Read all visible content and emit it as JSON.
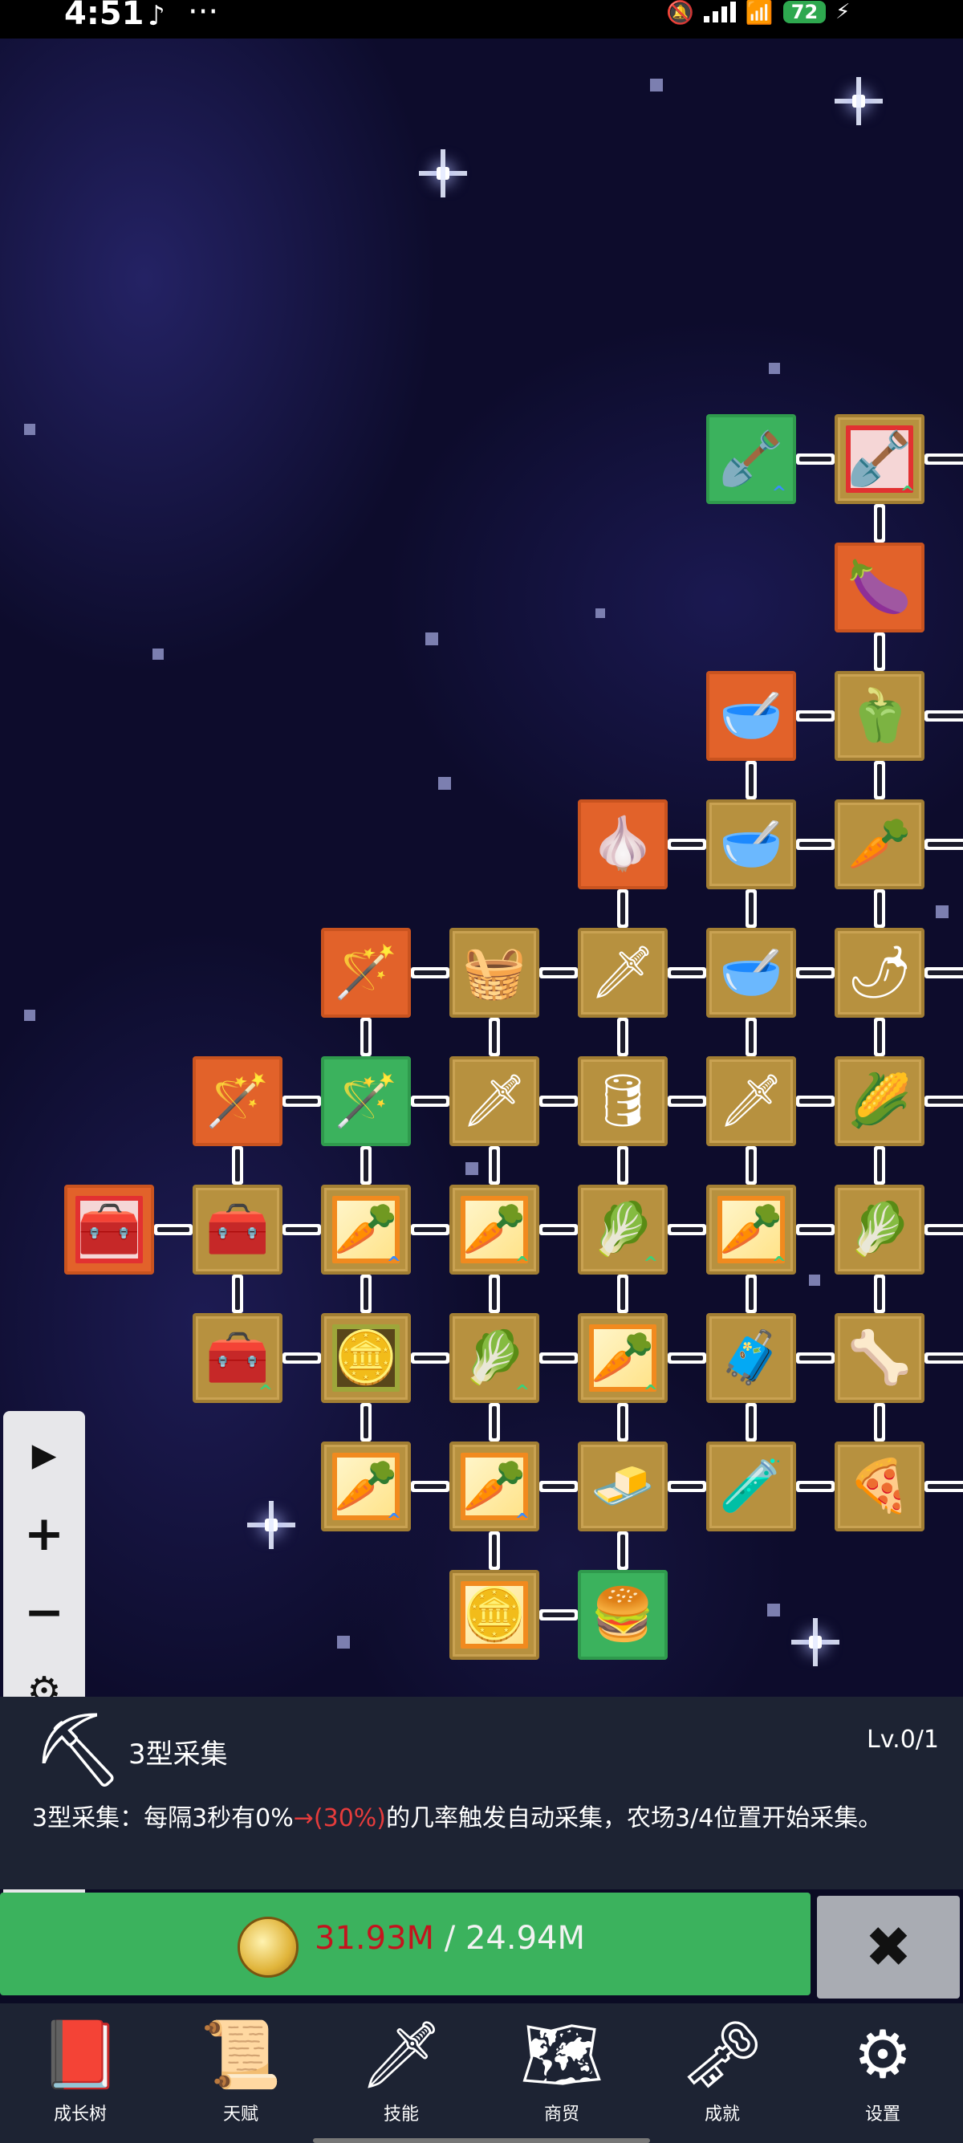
{
  "status_bar": {
    "time": "4:51",
    "more": "···",
    "app_icon": "tiktok-icon",
    "battery": "72"
  },
  "toolbar": {
    "buttons": [
      "play-icon",
      "zoom-in-icon",
      "zoom-out-icon",
      "settings-icon",
      "eye-icon",
      "move-icon",
      "close-icon"
    ]
  },
  "tree": {
    "nodes": [
      {
        "id": "n1",
        "icon": "shovel-icon",
        "style": "green",
        "upgrade": "blue"
      },
      {
        "id": "n2",
        "icon": "shovel-icon",
        "style": "gold",
        "frame": "red",
        "upgrade": "green"
      },
      {
        "id": "n3",
        "icon": "eggplant-icon",
        "style": "orange"
      },
      {
        "id": "n4",
        "icon": "bowl-icon",
        "style": "orange"
      },
      {
        "id": "n5",
        "icon": "pepper-icon",
        "style": "gold"
      },
      {
        "id": "n6",
        "icon": "garlic-icon",
        "style": "orange"
      },
      {
        "id": "n7",
        "icon": "bowl-icon",
        "style": "gold"
      },
      {
        "id": "n8",
        "icon": "radish-icon",
        "style": "gold"
      },
      {
        "id": "n9",
        "icon": "staff-icon",
        "style": "orange"
      },
      {
        "id": "n10",
        "icon": "crate-icon",
        "style": "gold"
      },
      {
        "id": "n11",
        "icon": "sword-icon",
        "style": "gold"
      },
      {
        "id": "n12",
        "icon": "bowl-icon",
        "style": "gold"
      },
      {
        "id": "n13",
        "icon": "chili-icon",
        "style": "gold"
      },
      {
        "id": "n14",
        "icon": "wand-icon",
        "style": "orange"
      },
      {
        "id": "n15",
        "icon": "staff-icon",
        "style": "green"
      },
      {
        "id": "n16",
        "icon": "sword-icon",
        "style": "gold"
      },
      {
        "id": "n17",
        "icon": "barrel-icon",
        "style": "gold"
      },
      {
        "id": "n18",
        "icon": "sword-icon",
        "style": "gold"
      },
      {
        "id": "n19",
        "icon": "corn-icon",
        "style": "gold"
      },
      {
        "id": "n20",
        "icon": "chest-icon",
        "style": "orange",
        "frame": "red"
      },
      {
        "id": "n21",
        "icon": "chest-icon",
        "style": "gold"
      },
      {
        "id": "n22",
        "icon": "carrot-icon",
        "style": "gold",
        "frame": "orange",
        "upgrade": "blue"
      },
      {
        "id": "n23",
        "icon": "carrot-icon",
        "style": "gold",
        "frame": "orange",
        "upgrade": "green"
      },
      {
        "id": "n24",
        "icon": "cabbage-icon",
        "style": "gold",
        "upgrade": "green"
      },
      {
        "id": "n25",
        "icon": "carrot-icon",
        "style": "gold",
        "frame": "orange",
        "upgrade": "green"
      },
      {
        "id": "n26",
        "icon": "cabbage-icon",
        "style": "gold"
      },
      {
        "id": "n27",
        "icon": "chest-icon",
        "style": "gold",
        "upgrade": "green"
      },
      {
        "id": "n28",
        "icon": "coin-icon",
        "style": "gold",
        "frame": "olive"
      },
      {
        "id": "n29",
        "icon": "cabbage-icon",
        "style": "gold",
        "upgrade": "green"
      },
      {
        "id": "n30",
        "icon": "carrot-icon",
        "style": "gold",
        "frame": "orange",
        "upgrade": "green"
      },
      {
        "id": "n31",
        "icon": "treasure-chest-icon",
        "style": "gold"
      },
      {
        "id": "n32",
        "icon": "parsnip-icon",
        "style": "gold"
      },
      {
        "id": "n33",
        "icon": "carrot-icon",
        "style": "gold",
        "frame": "orange",
        "upgrade": "blue"
      },
      {
        "id": "n34",
        "icon": "carrot-icon",
        "style": "gold",
        "frame": "orange",
        "upgrade": "blue"
      },
      {
        "id": "n35",
        "icon": "gold-bar-icon",
        "style": "gold"
      },
      {
        "id": "n36",
        "icon": "potion-icon",
        "style": "gold"
      },
      {
        "id": "n37",
        "icon": "pizza-icon",
        "style": "gold"
      },
      {
        "id": "n38",
        "icon": "coin-icon",
        "style": "gold",
        "frame": "orange"
      },
      {
        "id": "n39",
        "icon": "burger-icon",
        "style": "green"
      }
    ]
  },
  "detail": {
    "icon": "pickaxe-icon",
    "name": "3型采集",
    "level": "Lv.0/1",
    "desc_before": "3型采集：每隔3秒有0%",
    "desc_highlight": "→(30%)",
    "desc_after": "的几率触发自动采集，农场3/4位置开始采集。"
  },
  "cost": {
    "current": "31.93M",
    "separator": "/",
    "required": "24.94M",
    "colors": {
      "current": "#c4141e",
      "bar": "#3bb25d"
    }
  },
  "nav": {
    "items": [
      {
        "label": "成长树",
        "icon": "book-icon"
      },
      {
        "label": "天赋",
        "icon": "scroll-icon"
      },
      {
        "label": "技能",
        "icon": "sword-icon"
      },
      {
        "label": "商贸",
        "icon": "map-icon"
      },
      {
        "label": "成就",
        "icon": "key-icon"
      },
      {
        "label": "设置",
        "icon": "gear-icon"
      }
    ]
  }
}
